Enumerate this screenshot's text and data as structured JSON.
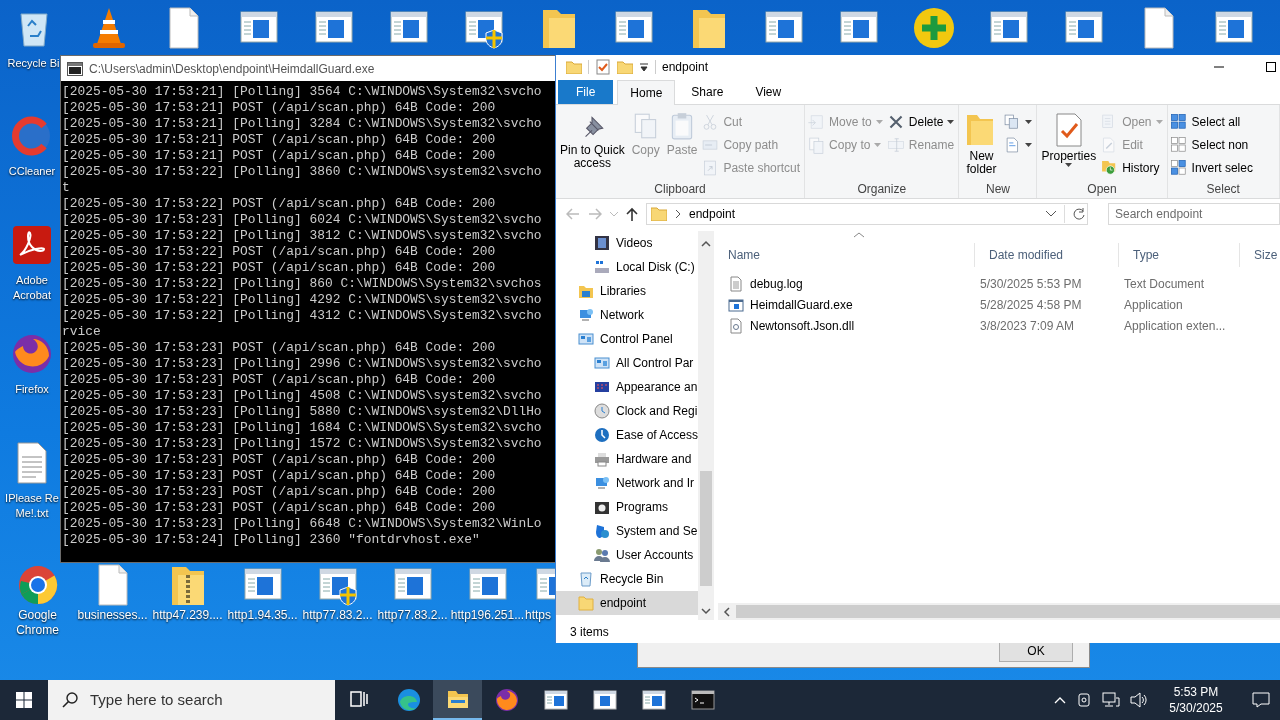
{
  "desktop": {
    "top_row": [
      {
        "kind": "recycle",
        "label": "Recycle Bi"
      },
      {
        "kind": "cone"
      },
      {
        "kind": "blank"
      },
      {
        "kind": "window"
      },
      {
        "kind": "window"
      },
      {
        "kind": "window"
      },
      {
        "kind": "shield"
      },
      {
        "kind": "folder"
      },
      {
        "kind": "window"
      },
      {
        "kind": "folder"
      },
      {
        "kind": "window"
      },
      {
        "kind": "window"
      },
      {
        "kind": "plus"
      },
      {
        "kind": "window"
      },
      {
        "kind": "window"
      },
      {
        "kind": "blank"
      },
      {
        "kind": "window"
      }
    ],
    "left_column": [
      {
        "kind": "cleaner",
        "label": "CCleaner"
      },
      {
        "kind": "pdf",
        "label": "Adobe\nAcrobat"
      },
      {
        "kind": "fox",
        "label": "Firefox"
      },
      {
        "kind": "text",
        "label": "IPlease Re\nMe!.txt"
      }
    ],
    "bottom_row": [
      {
        "kind": "chrome",
        "label": "Google\nChrome"
      },
      {
        "kind": "blank",
        "label": "businesses..."
      },
      {
        "kind": "zip",
        "label": "http47.239...."
      },
      {
        "kind": "window",
        "label": "http1.94.35..."
      },
      {
        "kind": "shield",
        "label": "http77.83.2..."
      },
      {
        "kind": "window",
        "label": "http77.83.2..."
      },
      {
        "kind": "window",
        "label": "http196.251..."
      },
      {
        "kind": "window",
        "label": "https"
      }
    ]
  },
  "console": {
    "title": "C:\\Users\\admin\\Desktop\\endpoint\\HeimdallGuard.exe",
    "lines": [
      "[2025-05-30 17:53:21] [Polling] 3564 C:\\WINDOWS\\System32\\svcho",
      "[2025-05-30 17:53:21] POST (/api/scan.php) 64B Code: 200",
      "[2025-05-30 17:53:21] [Polling] 3284 C:\\WINDOWS\\System32\\svcho",
      "[2025-05-30 17:53:21] POST (/api/scan.php) 64B Code: 200",
      "[2025-05-30 17:53:21] POST (/api/scan.php) 64B Code: 200",
      "[2025-05-30 17:53:22] [Polling] 3860 C:\\WINDOWS\\system32\\svcho",
      "t",
      "[2025-05-30 17:53:22] POST (/api/scan.php) 64B Code: 200",
      "[2025-05-30 17:53:23] [Polling] 6024 C:\\WINDOWS\\System32\\svcho",
      "[2025-05-30 17:53:22] [Polling] 3812 C:\\WINDOWS\\system32\\svcho",
      "[2025-05-30 17:53:22] POST (/api/scan.php) 64B Code: 200",
      "[2025-05-30 17:53:22] POST (/api/scan.php) 64B Code: 200",
      "[2025-05-30 17:53:22] [Polling] 860 C:\\WINDOWS\\System32\\svchos",
      "[2025-05-30 17:53:22] [Polling] 4292 C:\\WINDOWS\\system32\\svcho",
      "[2025-05-30 17:53:22] [Polling] 4312 C:\\WINDOWS\\System32\\svcho",
      "rvice",
      "[2025-05-30 17:53:23] POST (/api/scan.php) 64B Code: 200",
      "[2025-05-30 17:53:23] [Polling] 2996 C:\\WINDOWS\\system32\\svcho",
      "[2025-05-30 17:53:23] POST (/api/scan.php) 64B Code: 200",
      "[2025-05-30 17:53:23] [Polling] 4508 C:\\WINDOWS\\system32\\svcho",
      "[2025-05-30 17:53:23] [Polling] 5880 C:\\WINDOWS\\system32\\DllHo",
      "[2025-05-30 17:53:23] [Polling] 1684 C:\\WINDOWS\\System32\\svcho",
      "[2025-05-30 17:53:23] [Polling] 1572 C:\\WINDOWS\\System32\\svcho",
      "[2025-05-30 17:53:23] POST (/api/scan.php) 64B Code: 200",
      "[2025-05-30 17:53:23] POST (/api/scan.php) 64B Code: 200",
      "[2025-05-30 17:53:23] POST (/api/scan.php) 64B Code: 200",
      "[2025-05-30 17:53:23] POST (/api/scan.php) 64B Code: 200",
      "[2025-05-30 17:53:23] [Polling] 6648 C:\\WINDOWS\\System32\\WinLo",
      "[2025-05-30 17:53:24] [Polling] 2360 \"fontdrvhost.exe\""
    ]
  },
  "explorer": {
    "title": "endpoint",
    "tabs": [
      {
        "label": "File",
        "kind": "file",
        "selected": false
      },
      {
        "label": "Home",
        "kind": "tab",
        "selected": true
      },
      {
        "label": "Share",
        "kind": "tab",
        "selected": false
      },
      {
        "label": "View",
        "kind": "tab",
        "selected": false
      }
    ],
    "ribbon_groups": [
      {
        "label": "Clipboard",
        "columns": [
          [
            {
              "label": "Pin to Quick\naccess",
              "kind": "pin",
              "disabled": false
            }
          ],
          [
            {
              "label": "Copy",
              "kind": "copy",
              "disabled": true
            }
          ],
          [
            {
              "label": "Paste",
              "kind": "paste",
              "disabled": true
            }
          ],
          [
            {
              "label": "Cut",
              "kind": "cut",
              "disabled": true
            },
            {
              "label": "Copy path",
              "kind": "copy-path",
              "disabled": true
            },
            {
              "label": "Paste shortcut",
              "kind": "paste-shortcut",
              "disabled": true
            }
          ]
        ]
      },
      {
        "label": "Organize",
        "columns": [
          [
            {
              "label": "Move to",
              "kind": "move-to",
              "disabled": true,
              "dropdown": true
            },
            {
              "label": "Copy to",
              "kind": "copy-to",
              "disabled": true,
              "dropdown": true
            }
          ],
          [
            {
              "label": "Delete",
              "kind": "delete",
              "disabled": false,
              "dropdown": true
            },
            {
              "label": "Rename",
              "kind": "rename",
              "disabled": true
            }
          ]
        ]
      },
      {
        "label": "New",
        "columns": [
          [
            {
              "label": "New\nfolder",
              "kind": "new-folder",
              "disabled": false
            }
          ],
          [
            {
              "kind": "new-item",
              "disabled": false,
              "dropdown": true
            },
            {
              "kind": "easy-access",
              "disabled": false,
              "dropdown": true
            }
          ]
        ]
      },
      {
        "label": "Open",
        "columns": [
          [
            {
              "label": "Properties",
              "kind": "properties",
              "disabled": false,
              "dropdown": true
            }
          ],
          [
            {
              "label": "Open",
              "kind": "open",
              "disabled": true,
              "dropdown": true
            },
            {
              "label": "Edit",
              "kind": "edit",
              "disabled": true
            },
            {
              "label": "History",
              "kind": "history",
              "disabled": false
            }
          ]
        ]
      },
      {
        "label": "Select",
        "columns": [
          [
            {
              "label": "Select all",
              "kind": "select-all",
              "disabled": false
            },
            {
              "label": "Select non",
              "kind": "select-none",
              "disabled": false
            },
            {
              "label": "Invert selec",
              "kind": "invert-selection",
              "disabled": false
            }
          ]
        ]
      }
    ],
    "address": {
      "path": "endpoint",
      "search_placeholder": "Search endpoint"
    },
    "nav_pane": [
      {
        "children": [
          {
            "label": "Videos",
            "kind": "video",
            "selected": false
          },
          {
            "label": "Local Disk (C:)",
            "kind": "disk",
            "selected": false
          }
        ]
      },
      {
        "label": "Libraries",
        "kind": "library",
        "selected": false
      },
      {
        "label": "Network",
        "kind": "network",
        "selected": false
      },
      {
        "label": "Control Panel",
        "kind": "panel",
        "selected": false,
        "children": [
          {
            "label": "All Control Par",
            "kind": "panel",
            "selected": false
          },
          {
            "label": "Appearance an",
            "kind": "appearance",
            "selected": false
          },
          {
            "label": "Clock and Regi",
            "kind": "clock",
            "selected": false
          },
          {
            "label": "Ease of Access",
            "kind": "ease",
            "selected": false
          },
          {
            "label": "Hardware and",
            "kind": "printer",
            "selected": false
          },
          {
            "label": "Network and Ir",
            "kind": "network",
            "selected": false
          },
          {
            "label": "Programs",
            "kind": "programs",
            "selected": false
          },
          {
            "label": "System and Se",
            "kind": "shieldblue",
            "selected": false
          },
          {
            "label": "User Accounts",
            "kind": "users",
            "selected": false
          }
        ]
      },
      {
        "label": "Recycle Bin",
        "kind": "recycle",
        "selected": false
      },
      {
        "label": "endpoint",
        "kind": "folder",
        "selected": true
      }
    ],
    "columns": [
      "Name",
      "Date modified",
      "Type",
      "Size"
    ],
    "files": [
      {
        "name": "debug.log",
        "date": "5/30/2025 5:53 PM",
        "type": "Text Document",
        "kind": "text"
      },
      {
        "name": "HeimdallGuard.exe",
        "date": "5/28/2025 4:58 PM",
        "type": "Application",
        "kind": "app"
      },
      {
        "name": "Newtonsoft.Json.dll",
        "date": "3/8/2023 7:09 AM",
        "type": "Application exten...",
        "kind": "dll"
      }
    ],
    "status": "3 items"
  },
  "dialog": {
    "button": "OK"
  },
  "taskbar": {
    "search_placeholder": "Type here to search",
    "apps": [
      {
        "kind": "taskview",
        "active": false
      },
      {
        "kind": "edge",
        "active": false
      },
      {
        "kind": "explorer",
        "active": true
      },
      {
        "kind": "fox",
        "active": false
      },
      {
        "kind": "window",
        "active": false
      },
      {
        "kind": "window2",
        "active": false
      },
      {
        "kind": "window",
        "active": false
      },
      {
        "kind": "terminal",
        "active": false
      }
    ],
    "time": "5:53 PM",
    "date": "5/30/2025"
  }
}
